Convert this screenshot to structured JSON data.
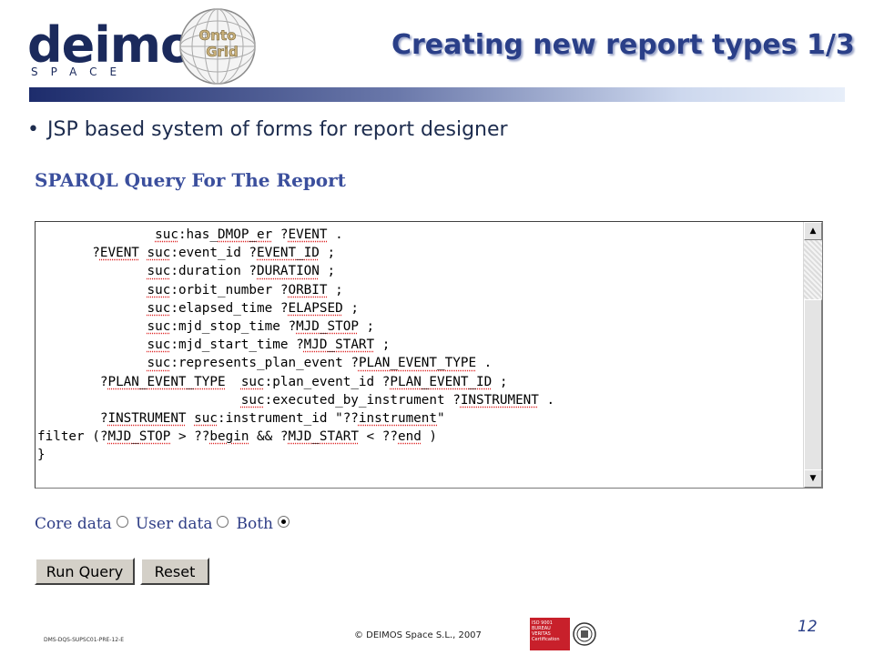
{
  "header": {
    "logo_text": "deimos",
    "logo_subtext": "SPACE",
    "globe_text": "Onto Grid",
    "title": "Creating new report types 1/3"
  },
  "bullet": {
    "text": "JSP based system of forms for report designer"
  },
  "form": {
    "heading": "SPARQL Query For The Report",
    "query_lines": [
      "               suc:has_DMOP_er ?EVENT .",
      "       ?EVENT suc:event_id ?EVENT_ID ;",
      "              suc:duration ?DURATION ;",
      "              suc:orbit_number ?ORBIT ;",
      "              suc:elapsed_time ?ELAPSED ;",
      "              suc:mjd_stop_time ?MJD_STOP ;",
      "              suc:mjd_start_time ?MJD_START ;",
      "              suc:represents_plan_event ?PLAN_EVENT_TYPE .",
      "        ?PLAN_EVENT_TYPE  suc:plan_event_id ?PLAN_EVENT_ID ;",
      "                          suc:executed_by_instrument ?INSTRUMENT .",
      "        ?INSTRUMENT suc:instrument_id \"??instrument\"",
      "filter (?MJD_STOP > ??begin && ?MJD_START < ??end )",
      "}"
    ],
    "radio_options": [
      {
        "label": "Core data",
        "selected": false
      },
      {
        "label": "User data",
        "selected": false
      },
      {
        "label": "Both",
        "selected": true
      }
    ],
    "run_button": "Run Query",
    "reset_button": "Reset"
  },
  "footer": {
    "page_number": "12",
    "doc_id": "DMS-DQS-SUPSC01-PRE-12-E",
    "copyright": "© DEIMOS Space S.L., 2007",
    "cert_text": "ISO 9001 BUREAU VERITAS Certification"
  },
  "colors": {
    "title": "#2a3f88",
    "heading": "#3b4f9d",
    "logo": "#1b2a5c",
    "cert_red": "#c8202b"
  }
}
